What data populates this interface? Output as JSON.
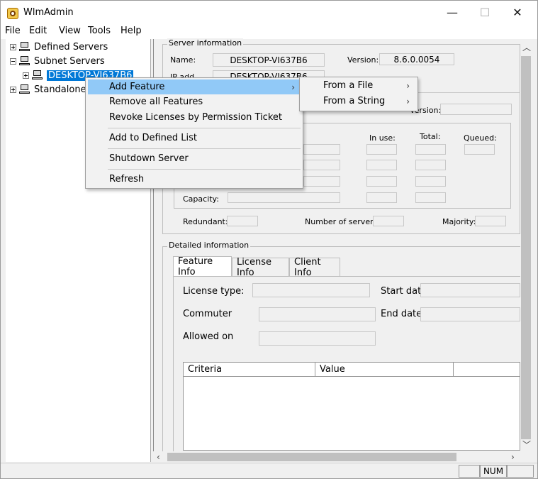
{
  "window": {
    "title": "WlmAdmin",
    "minimize": "—",
    "maximize": "☐",
    "close": "✕"
  },
  "menubar": [
    "File",
    "Edit",
    "View",
    "Tools",
    "Help"
  ],
  "tree": {
    "defined": "Defined Servers",
    "subnet": "Subnet Servers",
    "desktop": "DESKTOP-VI637B6",
    "standalone": "Standalone"
  },
  "server_info": {
    "title": "Server information",
    "name_label": "Name:",
    "name_value": "DESKTOP-VI637B6",
    "version_label": "Version:",
    "version_value": "8.6.0.0054",
    "ip_label": "IP add",
    "ip_value": "DESKTOP-VI637B6",
    "version2_label": "Version:"
  },
  "stats": {
    "inuse": "In use:",
    "total": "Total:",
    "queued": "Queued:",
    "capacity": "Capacity:",
    "redundant": "Redundant:",
    "num_servers": "Number of servers:",
    "majority": "Majority:"
  },
  "detailed": {
    "title": "Detailed information",
    "tabs": [
      "Feature Info",
      "License Info",
      "Client Info"
    ],
    "license_type": "License type:",
    "start_date": "Start date",
    "commuter": "Commuter",
    "end_date": "End date:",
    "allowed_on": "Allowed on",
    "columns": [
      "Criteria",
      "Value"
    ]
  },
  "context_menu": {
    "items": [
      "Add Feature",
      "Remove all Features",
      "Revoke Licenses by Permission Ticket",
      "Add to Defined List",
      "Shutdown Server",
      "Refresh"
    ],
    "submenu": [
      "From a File",
      "From a String"
    ]
  },
  "status": {
    "num": "NUM"
  }
}
